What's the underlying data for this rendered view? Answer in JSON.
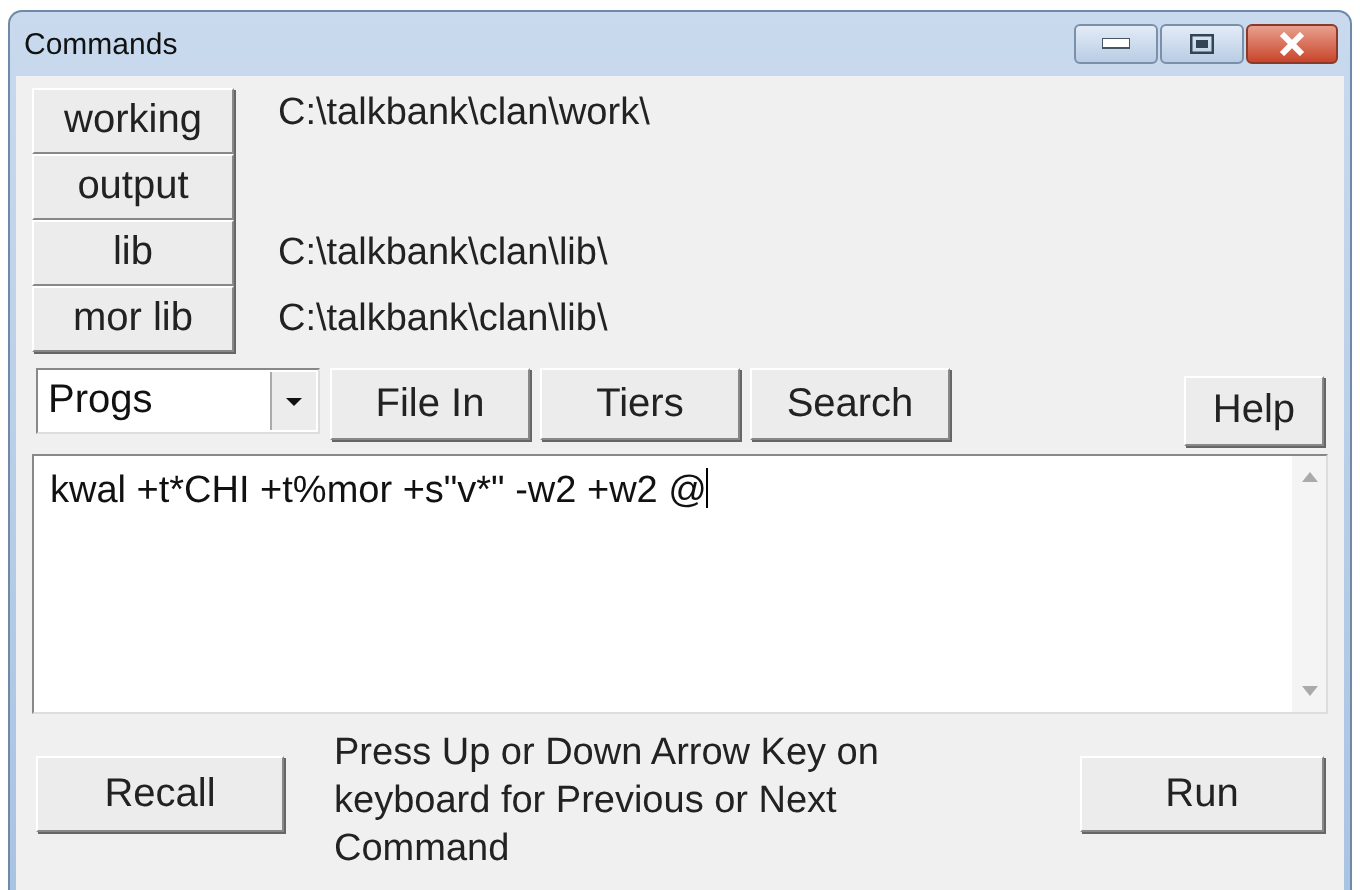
{
  "window": {
    "title": "Commands"
  },
  "directories": [
    {
      "label": "working",
      "path": "C:\\talkbank\\clan\\work\\"
    },
    {
      "label": "output"
    },
    {
      "label": "lib",
      "path": "C:\\talkbank\\clan\\lib\\"
    },
    {
      "label": "mor lib",
      "path": "C:\\talkbank\\clan\\lib\\"
    }
  ],
  "progs_dropdown": {
    "value": "Progs"
  },
  "toolbar_buttons": [
    "File In",
    "Tiers",
    "Search"
  ],
  "help_button": "Help",
  "command_field": {
    "value": "kwal +t*CHI +t%mor +s\"v*\" -w2 +w2 @"
  },
  "recall_button": "Recall",
  "hint": "Press Up or Down Arrow Key on keyboard for Previous or Next Command",
  "run_button": "Run"
}
